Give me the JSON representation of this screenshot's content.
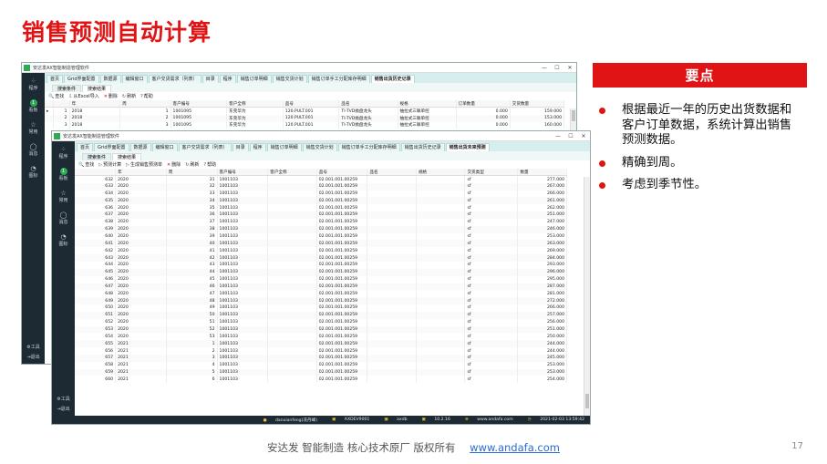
{
  "slide": {
    "title": "销售预测自动计算",
    "key_points_header": "要点",
    "bullets": [
      "根据最近一年的历史出货数据和客户订单数据，系统计算出销售预测数据。",
      "精确到周。",
      "考虑到季节性。"
    ],
    "footer_text": "安达发   智能制造 核心技术原厂   版权所有",
    "footer_link": "www.andafa.com",
    "page_number": "17"
  },
  "window_back": {
    "app_title": "安达发AX智能制造管理软件",
    "window_controls": [
      "—",
      "☐",
      "✕"
    ],
    "side_items": [
      {
        "icon": "grid-icon",
        "glyph": "⁘",
        "label": "程序"
      },
      {
        "icon": "dashboard-icon",
        "glyph": "1",
        "label": "看板"
      },
      {
        "icon": "star-icon",
        "glyph": "☆",
        "label": "常用"
      },
      {
        "icon": "message-icon",
        "glyph": "◯",
        "label": "消息"
      },
      {
        "icon": "pie-icon",
        "glyph": "◔",
        "label": "图标"
      }
    ],
    "side_bottom": [
      {
        "icon": "tools-icon",
        "glyph": "⚙",
        "label": "工具"
      },
      {
        "icon": "exit-icon",
        "glyph": "⇥",
        "label": "退出"
      }
    ],
    "tabs": [
      "首页",
      "Grid界面配置",
      "数据源",
      "编辑窗口",
      "客户交货需求（列表）",
      "目录",
      "程序",
      "销售订单明细",
      "销售交货计划",
      "销售订单手工分配库存明细",
      "销售出货历史记录"
    ],
    "active_tab": 10,
    "subtabs": [
      "搜索条件",
      "搜索结果"
    ],
    "active_subtab": 1,
    "toolbar": [
      {
        "icon": "search-icon",
        "glyph": "🔍",
        "label": "查找"
      },
      {
        "icon": "excel-import-icon",
        "glyph": "⇩",
        "label": "从Excel导入"
      },
      {
        "icon": "delete-icon",
        "glyph": "✕",
        "label": "删除"
      },
      {
        "icon": "refresh-icon",
        "glyph": "↻",
        "label": "刷新"
      },
      {
        "icon": "help-icon",
        "glyph": "?",
        "label": "帮助"
      }
    ],
    "columns": [
      "",
      "",
      "年",
      "周",
      "客户编号",
      "客户全称",
      "品号",
      "品名",
      "规格",
      "订单数量",
      "交货数量"
    ],
    "rows": [
      [
        "▸",
        "1",
        "2018",
        "1",
        "1001095",
        "东莞华为",
        "120.PULT.001",
        "TI-TVD抛盘龙头",
        "抽拉式三联单控",
        "0.000",
        "159.000"
      ],
      [
        "",
        "2",
        "2018",
        "2",
        "1001095",
        "东莞华为",
        "120.PULT.001",
        "TI-TVD抛盘龙头",
        "抽拉式三联单控",
        "0.000",
        "153.000"
      ],
      [
        "",
        "3",
        "2018",
        "3",
        "1001095",
        "东莞华为",
        "120.PULT.001",
        "TI-TVD抛盘龙头",
        "抽拉式三联单控",
        "0.000",
        "160.000"
      ]
    ]
  },
  "window_front": {
    "app_title": "安达发AX智能制造管理软件",
    "window_controls": [
      "—",
      "☐",
      "✕"
    ],
    "side_items": [
      {
        "icon": "grid-icon",
        "glyph": "⁘",
        "label": "程序"
      },
      {
        "icon": "dashboard-icon",
        "glyph": "1",
        "label": "看板"
      },
      {
        "icon": "star-icon",
        "glyph": "☆",
        "label": "常用"
      },
      {
        "icon": "message-icon",
        "glyph": "◯",
        "label": "消息"
      },
      {
        "icon": "pie-icon",
        "glyph": "◔",
        "label": "图标"
      }
    ],
    "side_bottom": [
      {
        "icon": "tools-icon",
        "glyph": "⚙",
        "label": "工具"
      },
      {
        "icon": "exit-icon",
        "glyph": "⇥",
        "label": "退出"
      }
    ],
    "tabs": [
      "首页",
      "Grid界面配置",
      "数据源",
      "编辑窗口",
      "客户交货需求（列表）",
      "目录",
      "程序",
      "销售订单明细",
      "销售交货计划",
      "销售订单手工分配库存明细",
      "销售出货历史记录",
      "销售出货未来预测"
    ],
    "active_tab": 11,
    "subtabs": [
      "搜索条件",
      "搜索结果"
    ],
    "active_subtab": 1,
    "toolbar": [
      {
        "icon": "search-icon",
        "glyph": "🔍",
        "label": "查找"
      },
      {
        "icon": "forecast-calc-icon",
        "glyph": "▷",
        "label": "预测计算"
      },
      {
        "icon": "generate-forecast-icon",
        "glyph": "▷",
        "label": "生成销售预测单"
      },
      {
        "icon": "delete-icon",
        "glyph": "✕",
        "label": "删除"
      },
      {
        "icon": "refresh-icon",
        "glyph": "↻",
        "label": "刷新"
      },
      {
        "icon": "help-icon",
        "glyph": "?",
        "label": "帮助"
      }
    ],
    "columns": [
      "",
      "年",
      "周",
      "客户编号",
      "客户全称",
      "品号",
      "品名",
      "规格",
      "交货类型",
      "数量"
    ],
    "rows": [
      [
        "632",
        "2020",
        "31",
        "1001103",
        "",
        "02.001.001.00259",
        "",
        "",
        "sf",
        "277.000"
      ],
      [
        "633",
        "2020",
        "32",
        "1001103",
        "",
        "02.001.001.00259",
        "",
        "",
        "sf",
        "267.000"
      ],
      [
        "634",
        "2020",
        "33",
        "1001103",
        "",
        "02.001.001.00259",
        "",
        "",
        "sf",
        "266.000"
      ],
      [
        "635",
        "2020",
        "34",
        "1001103",
        "",
        "02.001.001.00259",
        "",
        "",
        "sf",
        "261.000"
      ],
      [
        "636",
        "2020",
        "35",
        "1001103",
        "",
        "02.001.001.00259",
        "",
        "",
        "sf",
        "262.000"
      ],
      [
        "637",
        "2020",
        "36",
        "1001103",
        "",
        "02.001.001.00259",
        "",
        "",
        "sf",
        "251.000"
      ],
      [
        "638",
        "2020",
        "37",
        "1001103",
        "",
        "02.001.001.00259",
        "",
        "",
        "sf",
        "247.000"
      ],
      [
        "639",
        "2020",
        "38",
        "1001103",
        "",
        "02.001.001.00259",
        "",
        "",
        "sf",
        "246.000"
      ],
      [
        "640",
        "2020",
        "39",
        "1001103",
        "",
        "02.001.001.00259",
        "",
        "",
        "sf",
        "253.000"
      ],
      [
        "641",
        "2020",
        "40",
        "1001103",
        "",
        "02.001.001.00259",
        "",
        "",
        "sf",
        "263.000"
      ],
      [
        "642",
        "2020",
        "41",
        "1001103",
        "",
        "02.001.001.00259",
        "",
        "",
        "sf",
        "269.000"
      ],
      [
        "643",
        "2020",
        "42",
        "1001103",
        "",
        "02.001.001.00259",
        "",
        "",
        "sf",
        "284.000"
      ],
      [
        "644",
        "2020",
        "43",
        "1001103",
        "",
        "02.001.001.00259",
        "",
        "",
        "sf",
        "293.000"
      ],
      [
        "645",
        "2020",
        "44",
        "1001103",
        "",
        "02.001.001.00259",
        "",
        "",
        "sf",
        "296.000"
      ],
      [
        "646",
        "2020",
        "45",
        "1001103",
        "",
        "02.001.001.00259",
        "",
        "",
        "sf",
        "295.000"
      ],
      [
        "647",
        "2020",
        "46",
        "1001103",
        "",
        "02.001.001.00259",
        "",
        "",
        "sf",
        "287.000"
      ],
      [
        "648",
        "2020",
        "47",
        "1001103",
        "",
        "02.001.001.00259",
        "",
        "",
        "sf",
        "281.000"
      ],
      [
        "649",
        "2020",
        "48",
        "1001103",
        "",
        "02.001.001.00259",
        "",
        "",
        "sf",
        "272.000"
      ],
      [
        "650",
        "2020",
        "49",
        "1001103",
        "",
        "02.001.001.00259",
        "",
        "",
        "sf",
        "266.000"
      ],
      [
        "651",
        "2020",
        "50",
        "1001103",
        "",
        "02.001.001.00259",
        "",
        "",
        "sf",
        "257.000"
      ],
      [
        "652",
        "2020",
        "51",
        "1001103",
        "",
        "02.001.001.00259",
        "",
        "",
        "sf",
        "256.000"
      ],
      [
        "653",
        "2020",
        "52",
        "1001103",
        "",
        "02.001.001.00259",
        "",
        "",
        "sf",
        "251.000"
      ],
      [
        "654",
        "2020",
        "53",
        "1001103",
        "",
        "02.001.001.00259",
        "",
        "",
        "sf",
        "250.000"
      ],
      [
        "655",
        "2021",
        "1",
        "1001103",
        "",
        "02.001.001.00259",
        "",
        "",
        "sf",
        "244.000"
      ],
      [
        "656",
        "2021",
        "2",
        "1001103",
        "",
        "02.001.001.00259",
        "",
        "",
        "sf",
        "244.000"
      ],
      [
        "657",
        "2021",
        "3",
        "1001103",
        "",
        "02.001.001.00259",
        "",
        "",
        "sf",
        "245.000"
      ],
      [
        "658",
        "2021",
        "4",
        "1001103",
        "",
        "02.001.001.00259",
        "",
        "",
        "sf",
        "253.000"
      ],
      [
        "659",
        "2021",
        "5",
        "1001103",
        "",
        "02.001.001.00259",
        "",
        "",
        "sf",
        "253.000"
      ],
      [
        "660",
        "2021",
        "6",
        "1001103",
        "",
        "02.001.001.00259",
        "",
        "",
        "sf",
        "254.000"
      ]
    ],
    "status": {
      "user": "danxianfeng(冼丹峰)",
      "db": "AXDEV9001",
      "schema": "axdb",
      "ip": "10.2.16",
      "site": "www.andafa.com",
      "datetime": "2021-02-03 13:59:42"
    }
  }
}
